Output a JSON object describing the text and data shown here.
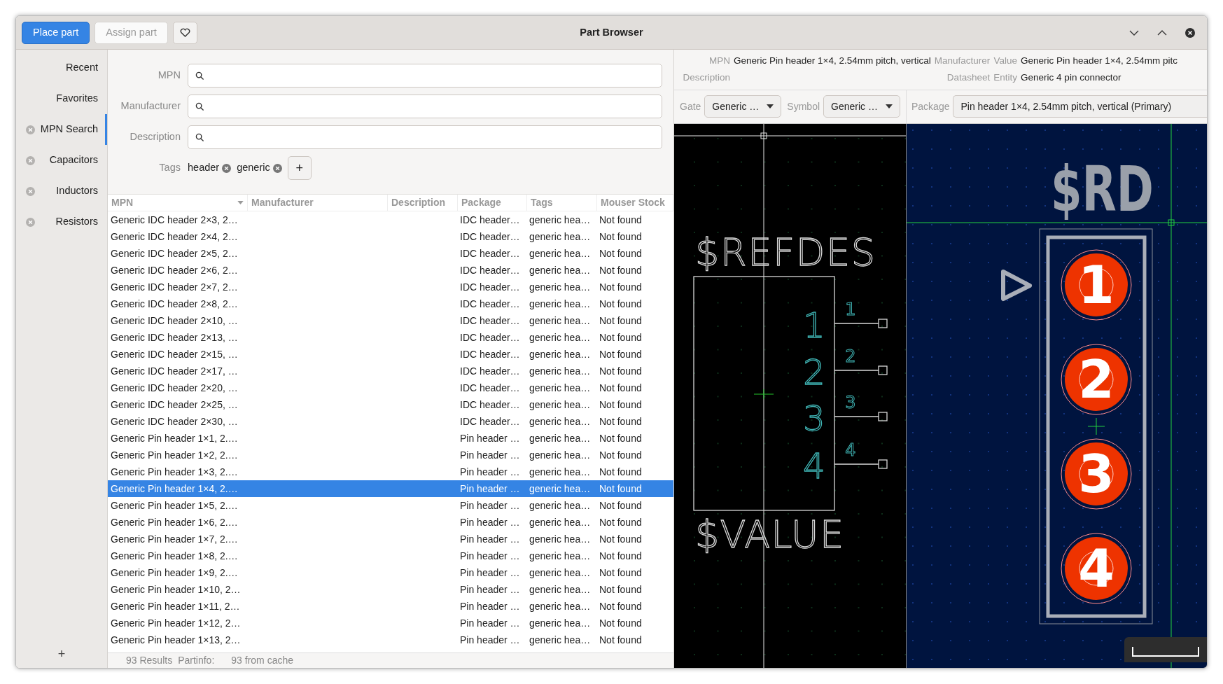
{
  "header": {
    "buttons": [
      {
        "label": "Place part",
        "kind": "primary"
      },
      {
        "label": "Assign part",
        "kind": "disabled"
      }
    ],
    "title": "Part Browser"
  },
  "sidebar": {
    "items": [
      {
        "label": "Recent",
        "closable": false,
        "selected": false
      },
      {
        "label": "Favorites",
        "closable": false,
        "selected": false
      },
      {
        "label": "MPN Search",
        "closable": true,
        "selected": true
      },
      {
        "label": "Capacitors",
        "closable": true,
        "selected": false
      },
      {
        "label": "Inductors",
        "closable": true,
        "selected": false
      },
      {
        "label": "Resistors",
        "closable": true,
        "selected": false
      }
    ],
    "add_button": "+"
  },
  "filters": {
    "fields": [
      {
        "label": "MPN"
      },
      {
        "label": "Manufacturer"
      },
      {
        "label": "Description"
      }
    ],
    "tags_label": "Tags",
    "tags": [
      "header",
      "generic"
    ],
    "add_tag": "+"
  },
  "table": {
    "columns": [
      {
        "label": "MPN",
        "sorted": true
      },
      {
        "label": "Manufacturer",
        "sorted": false
      },
      {
        "label": "Description",
        "sorted": false
      },
      {
        "label": "Package",
        "sorted": false
      },
      {
        "label": "Tags",
        "sorted": false
      },
      {
        "label": "Mouser Stock",
        "sorted": false
      }
    ],
    "rows": [
      {
        "mpn": "Generic IDC header 2×3, 2…",
        "package": "IDC header…",
        "tags": "generic hea…",
        "stock": "Not found",
        "selected": false
      },
      {
        "mpn": "Generic IDC header 2×4, 2…",
        "package": "IDC header…",
        "tags": "generic hea…",
        "stock": "Not found",
        "selected": false
      },
      {
        "mpn": "Generic IDC header 2×5, 2…",
        "package": "IDC header…",
        "tags": "generic hea…",
        "stock": "Not found",
        "selected": false
      },
      {
        "mpn": "Generic IDC header 2×6, 2…",
        "package": "IDC header…",
        "tags": "generic hea…",
        "stock": "Not found",
        "selected": false
      },
      {
        "mpn": "Generic IDC header 2×7, 2…",
        "package": "IDC header…",
        "tags": "generic hea…",
        "stock": "Not found",
        "selected": false
      },
      {
        "mpn": "Generic IDC header 2×8, 2…",
        "package": "IDC header…",
        "tags": "generic hea…",
        "stock": "Not found",
        "selected": false
      },
      {
        "mpn": "Generic IDC header 2×10, …",
        "package": "IDC header…",
        "tags": "generic hea…",
        "stock": "Not found",
        "selected": false
      },
      {
        "mpn": "Generic IDC header 2×13, …",
        "package": "IDC header…",
        "tags": "generic hea…",
        "stock": "Not found",
        "selected": false
      },
      {
        "mpn": "Generic IDC header 2×15, …",
        "package": "IDC header…",
        "tags": "generic hea…",
        "stock": "Not found",
        "selected": false
      },
      {
        "mpn": "Generic IDC header 2×17, …",
        "package": "IDC header…",
        "tags": "generic hea…",
        "stock": "Not found",
        "selected": false
      },
      {
        "mpn": "Generic IDC header 2×20, …",
        "package": "IDC header…",
        "tags": "generic hea…",
        "stock": "Not found",
        "selected": false
      },
      {
        "mpn": "Generic IDC header 2×25, …",
        "package": "IDC header…",
        "tags": "generic hea…",
        "stock": "Not found",
        "selected": false
      },
      {
        "mpn": "Generic IDC header 2×30, …",
        "package": "IDC header…",
        "tags": "generic hea…",
        "stock": "Not found",
        "selected": false
      },
      {
        "mpn": "Generic Pin header 1×1, 2.…",
        "package": "Pin header …",
        "tags": "generic hea…",
        "stock": "Not found",
        "selected": false
      },
      {
        "mpn": "Generic Pin header 1×2, 2.…",
        "package": "Pin header …",
        "tags": "generic hea…",
        "stock": "Not found",
        "selected": false
      },
      {
        "mpn": "Generic Pin header 1×3, 2.…",
        "package": "Pin header …",
        "tags": "generic hea…",
        "stock": "Not found",
        "selected": false
      },
      {
        "mpn": "Generic Pin header 1×4, 2.…",
        "package": "Pin header …",
        "tags": "generic hea…",
        "stock": "Not found",
        "selected": true
      },
      {
        "mpn": "Generic Pin header 1×5, 2.…",
        "package": "Pin header …",
        "tags": "generic hea…",
        "stock": "Not found",
        "selected": false
      },
      {
        "mpn": "Generic Pin header 1×6, 2.…",
        "package": "Pin header …",
        "tags": "generic hea…",
        "stock": "Not found",
        "selected": false
      },
      {
        "mpn": "Generic Pin header 1×7, 2.…",
        "package": "Pin header …",
        "tags": "generic hea…",
        "stock": "Not found",
        "selected": false
      },
      {
        "mpn": "Generic Pin header 1×8, 2.…",
        "package": "Pin header …",
        "tags": "generic hea…",
        "stock": "Not found",
        "selected": false
      },
      {
        "mpn": "Generic Pin header 1×9, 2.…",
        "package": "Pin header …",
        "tags": "generic hea…",
        "stock": "Not found",
        "selected": false
      },
      {
        "mpn": "Generic Pin header 1×10, 2…",
        "package": "Pin header …",
        "tags": "generic hea…",
        "stock": "Not found",
        "selected": false
      },
      {
        "mpn": "Generic Pin header 1×11, 2…",
        "package": "Pin header …",
        "tags": "generic hea…",
        "stock": "Not found",
        "selected": false
      },
      {
        "mpn": "Generic Pin header 1×12, 2…",
        "package": "Pin header …",
        "tags": "generic hea…",
        "stock": "Not found",
        "selected": false
      },
      {
        "mpn": "Generic Pin header 1×13, 2…",
        "package": "Pin header …",
        "tags": "generic hea…",
        "stock": "Not found",
        "selected": false
      }
    ]
  },
  "status_bar": {
    "results": "93 Results",
    "partinfo_label": "Partinfo:",
    "partinfo": "93 from cache"
  },
  "details": {
    "mpn_label": "MPN",
    "mpn": "Generic Pin header 1×4, 2.54mm pitch, vertical",
    "manufacturer_label": "Manufacturer",
    "value_label": "Value",
    "value": "Generic Pin header 1×4, 2.54mm pitc",
    "description_label": "Description",
    "datasheet_label": "Datasheet",
    "entity_label": "Entity",
    "entity": "Generic 4 pin connector"
  },
  "selectors": {
    "gate": {
      "label": "Gate",
      "value": "Generic …"
    },
    "symbol": {
      "label": "Symbol",
      "value": "Generic …"
    },
    "package": {
      "label": "Package",
      "value": "Pin header 1×4, 2.54mm pitch, vertical (Primary)"
    }
  },
  "symbol_preview": {
    "refdes": "$REFDES",
    "value": "$VALUE",
    "pins": [
      {
        "name": "1",
        "number": "1"
      },
      {
        "name": "2",
        "number": "2"
      },
      {
        "name": "3",
        "number": "3"
      },
      {
        "name": "4",
        "number": "4"
      }
    ]
  },
  "package_preview": {
    "refdes": "$RD",
    "pads": [
      "1",
      "2",
      "3",
      "4"
    ]
  }
}
